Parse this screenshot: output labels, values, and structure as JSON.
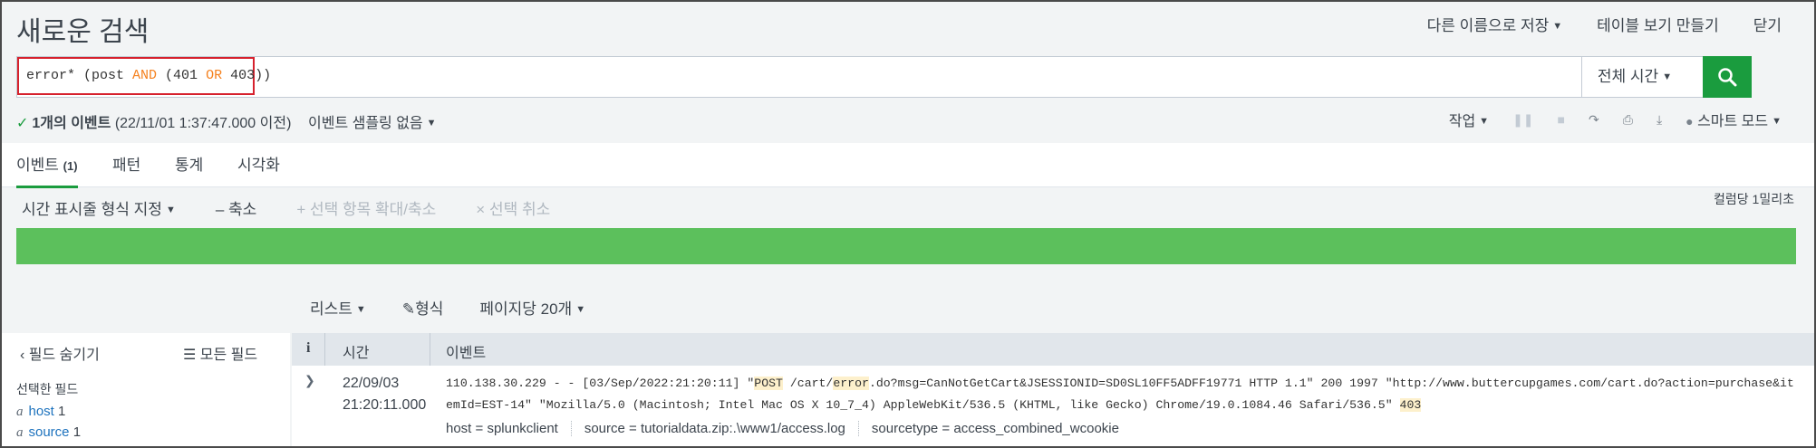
{
  "header": {
    "title": "새로운 검색",
    "save_as": "다른 이름으로 저장",
    "create_table_view": "테이블 보기 만들기",
    "close": "닫기"
  },
  "search": {
    "query_parts": [
      "error* (post ",
      "AND",
      " (401 ",
      "OR",
      " 403))"
    ],
    "time_picker": "전체 시간",
    "search_icon": "magnifier-icon"
  },
  "status": {
    "count": "1개의 이벤트",
    "timestamp": "(22/11/01 1:37:47.000 이전)",
    "sampling": "이벤트 샘플링 없음",
    "job": "작업",
    "mode": "스마트 모드"
  },
  "tabs": [
    {
      "label": "이벤트",
      "count": "(1)"
    },
    {
      "label": "패턴"
    },
    {
      "label": "통계"
    },
    {
      "label": "시각화"
    }
  ],
  "timeline": {
    "format": "시간 표시줄 형식 지정",
    "zoom_out": "축소",
    "zoom_selection": "선택 항목 확대/축소",
    "deselect": "선택 취소",
    "scale": "컬럼당 1밀리초",
    "bar_color": "#5cc05c"
  },
  "list_controls": {
    "list": "리스트",
    "format": "형식",
    "per_page": "페이지당 20개"
  },
  "sidebar": {
    "hide_fields": "필드 숨기기",
    "all_fields": "모든 필드",
    "selected_fields": "선택한 필드",
    "fields": [
      {
        "type": "a",
        "name": "host",
        "count": "1"
      },
      {
        "type": "a",
        "name": "source",
        "count": "1"
      }
    ]
  },
  "events": {
    "headers": {
      "info": "i",
      "time": "시간",
      "event": "이벤트"
    },
    "rows": [
      {
        "date": "22/09/03",
        "time": "21:20:11.000",
        "raw_parts": [
          "110.138.30.229 - - [03/Sep/2022:21:20:11] \"",
          "POST",
          " /cart/",
          "error",
          ".do?msg=CanNotGetCart&JSESSIONID=SD0SL10FF5ADFF19771 HTTP 1.1\" 200 1997 \"http://www.buttercupgames.com/cart.do?action=purchase&itemId=EST-14\" \"Mozilla/5.0 (Macintosh; Intel Mac OS X 10_7_4) AppleWebKit/536.5 (KHTML, like Gecko) Chrome/19.0.1084.46 Safari/536.5\" ",
          "403"
        ],
        "fields": [
          "host = splunkclient",
          "source = tutorialdata.zip:.\\www1/access.log",
          "sourcetype = access_combined_wcookie"
        ]
      }
    ]
  },
  "colors": {
    "accent_green": "#1a9c3e",
    "keyword_orange": "#f58220",
    "highlight": "#fdf0cc",
    "query_border": "#d6212d"
  }
}
